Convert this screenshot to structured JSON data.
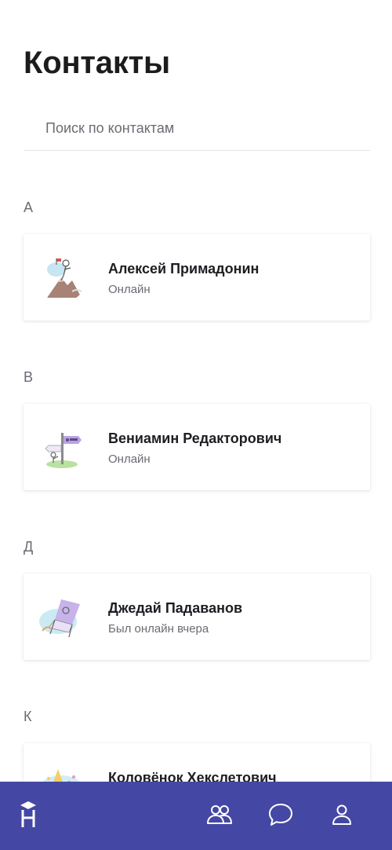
{
  "header": {
    "title": "Контакты"
  },
  "search": {
    "placeholder": "Поиск по контактам",
    "value": ""
  },
  "sections": [
    {
      "letter": "А",
      "contacts": [
        {
          "name": "Алексей Примадонин",
          "status": "Онлайн",
          "avatar": "mountain-climber-illustration"
        }
      ]
    },
    {
      "letter": "В",
      "contacts": [
        {
          "name": "Вениамин Редакторович",
          "status": "Онлайн",
          "avatar": "signpost-illustration"
        }
      ]
    },
    {
      "letter": "Д",
      "contacts": [
        {
          "name": "Джедай Падаванов",
          "status": "Был онлайн вчера",
          "avatar": "beach-chair-illustration"
        }
      ]
    },
    {
      "letter": "К",
      "contacts": [
        {
          "name": "Коловёнок Хекслетович",
          "status": "",
          "avatar": "party-illustration"
        }
      ]
    }
  ],
  "bottom_nav": {
    "background": "#4547a4",
    "items": [
      {
        "icon": "hexlet-logo-icon"
      },
      {
        "icon": "contacts-icon"
      },
      {
        "icon": "chat-bubble-icon"
      },
      {
        "icon": "profile-icon"
      }
    ]
  }
}
